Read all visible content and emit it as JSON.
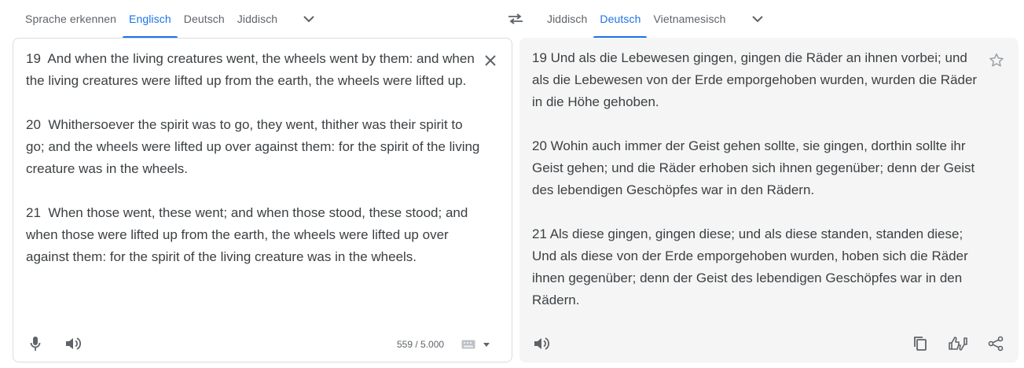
{
  "source_tabs": [
    {
      "label": "Sprache erkennen",
      "active": false
    },
    {
      "label": "Englisch",
      "active": true
    },
    {
      "label": "Deutsch",
      "active": false
    },
    {
      "label": "Jiddisch",
      "active": false
    }
  ],
  "target_tabs": [
    {
      "label": "Jiddisch",
      "active": false
    },
    {
      "label": "Deutsch",
      "active": true
    },
    {
      "label": "Vietnamesisch",
      "active": false
    }
  ],
  "source": {
    "text": "19  And when the living creatures went, the wheels went by them: and when the living creatures were lifted up from the earth, the wheels were lifted up.\n\n20  Whithersoever the spirit was to go, they went, thither was their spirit to go; and the wheels were lifted up over against them: for the spirit of the living creature was in the wheels.\n\n21  When those went, these went; and when those stood, these stood; and when those were lifted up from the earth, the wheels were lifted up over against them: for the spirit of the living creature was in the wheels.",
    "char_count": "559 / 5.000"
  },
  "target": {
    "text": "19 Und als die Lebewesen gingen, gingen die Räder an ihnen vorbei; und als die Lebewesen von der Erde emporgehoben wurden, wurden die Räder in die Höhe gehoben.\n\n20 Wohin auch immer der Geist gehen sollte, sie gingen, dorthin sollte ihr Geist gehen; und die Räder erhoben sich ihnen gegenüber; denn der Geist des lebendigen Geschöpfes war in den Rädern.\n\n21 Als diese gingen, gingen diese; und als diese standen, standen diese; Und als diese von der Erde emporgehoben wurden, hoben sich die Räder ihnen gegenüber; denn der Geist des lebendigen Geschöpfes war in den Rädern."
  },
  "icons": {
    "more_languages": "chevron-down-icon",
    "swap": "swap-languages-icon",
    "clear": "close-icon",
    "mic": "microphone-icon",
    "listen": "speaker-icon",
    "keyboard": "keyboard-icon",
    "star": "star-icon",
    "copy": "copy-icon",
    "feedback": "thumbs-feedback-icon",
    "share": "share-icon"
  },
  "colors": {
    "accent": "#1a73e8",
    "text": "#3c4043",
    "muted": "#5f6368",
    "target_bg": "#f5f5f5"
  }
}
